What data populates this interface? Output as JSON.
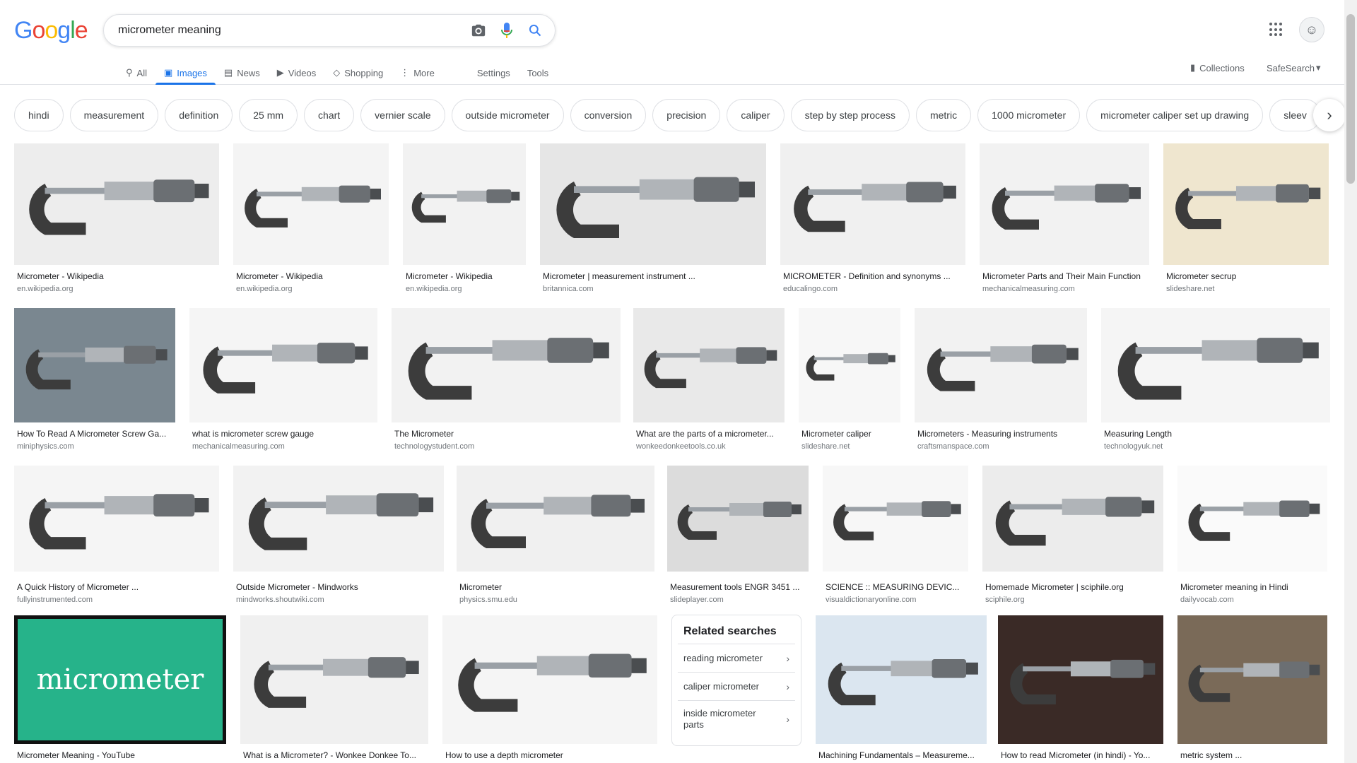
{
  "logo": {
    "letters": [
      "G",
      "o",
      "o",
      "g",
      "l",
      "e"
    ],
    "colors": [
      "#4285f4",
      "#ea4335",
      "#fbbc05",
      "#4285f4",
      "#34a853",
      "#ea4335"
    ]
  },
  "search": {
    "value": "micrometer meaning"
  },
  "tabs": [
    {
      "label": "All",
      "icon": "search-icon"
    },
    {
      "label": "Images",
      "icon": "image-icon",
      "active": true
    },
    {
      "label": "News",
      "icon": "news-icon"
    },
    {
      "label": "Videos",
      "icon": "video-icon"
    },
    {
      "label": "Shopping",
      "icon": "tag-icon"
    },
    {
      "label": "More",
      "icon": "more-vert-icon"
    }
  ],
  "tools": {
    "settings": "Settings",
    "tools": "Tools"
  },
  "collections": "Collections",
  "safesearch": "SafeSearch",
  "chips": [
    "hindi",
    "measurement",
    "definition",
    "25 mm",
    "chart",
    "vernier scale",
    "outside micrometer",
    "conversion",
    "precision",
    "caliper",
    "step by step process",
    "metric",
    "1000 micrometer",
    "micrometer caliper set up drawing",
    "sleev"
  ],
  "results": [
    {
      "title": "Micrometer - Wikipedia",
      "source": "en.wikipedia.org",
      "bg": "#ededed"
    },
    {
      "title": "Micrometer - Wikipedia",
      "source": "en.wikipedia.org",
      "bg": "#f4f4f4"
    },
    {
      "title": "Micrometer - Wikipedia",
      "source": "en.wikipedia.org",
      "bg": "#f2f2f2"
    },
    {
      "title": "Micrometer | measurement instrument ...",
      "source": "britannica.com",
      "bg": "#e6e6e6"
    },
    {
      "title": "MICROMETER - Definition and synonyms ...",
      "source": "educalingo.com",
      "bg": "#f0f0f0"
    },
    {
      "title": "Micrometer Parts and Their Main Function",
      "source": "mechanicalmeasuring.com",
      "bg": "#f2f2f2"
    },
    {
      "title": "Micrometer secrup",
      "source": "slideshare.net",
      "bg": "#efe6cf"
    },
    {
      "title": "How To Read A Micrometer Screw Ga...",
      "source": "miniphysics.com",
      "bg": "#7a8790"
    },
    {
      "title": "what is micrometer screw gauge",
      "source": "mechanicalmeasuring.com",
      "bg": "#f5f5f5"
    },
    {
      "title": "The Micrometer",
      "source": "technologystudent.com",
      "bg": "#f2f2f2"
    },
    {
      "title": "What are the parts of a micrometer...",
      "source": "wonkeedonkeetools.co.uk",
      "bg": "#e9e9e9"
    },
    {
      "title": "Micrometer caliper",
      "source": "slideshare.net",
      "bg": "#f7f7f7"
    },
    {
      "title": "Micrometers - Measuring instruments",
      "source": "craftsmanspace.com",
      "bg": "#f2f2f2"
    },
    {
      "title": "Measuring Length",
      "source": "technologyuk.net",
      "bg": "#f5f5f5"
    },
    {
      "title": "A Quick History of Micrometer ...",
      "source": "fullyinstrumented.com",
      "bg": "#f5f5f5"
    },
    {
      "title": "Outside Micrometer - Mindworks",
      "source": "mindworks.shoutwiki.com",
      "bg": "#f2f2f2"
    },
    {
      "title": "Micrometer",
      "source": "physics.smu.edu",
      "bg": "#f0f0f0"
    },
    {
      "title": "Measurement tools ENGR 3451 ...",
      "source": "slideplayer.com",
      "bg": "#dcdcdc"
    },
    {
      "title": "SCIENCE :: MEASURING DEVIC...",
      "source": "visualdictionaryonline.com",
      "bg": "#f7f7f7"
    },
    {
      "title": "Homemade Micrometer | sciphile.org",
      "source": "sciphile.org",
      "bg": "#ececec"
    },
    {
      "title": "Micrometer meaning in Hindi",
      "source": "dailyvocab.com",
      "bg": "#fafafa"
    },
    {
      "title": "Micrometer Meaning - YouTube",
      "source": "",
      "bg": "#26b38a",
      "overlay": "micrometer"
    },
    {
      "title": "What is a Micrometer? - Wonkee Donkee To...",
      "source": "",
      "bg": "#f0f0f0"
    },
    {
      "title": "How to use a depth micrometer",
      "source": "",
      "bg": "#f5f5f5"
    },
    {
      "title": "Machining Fundamentals – Measureme...",
      "source": "",
      "bg": "#dbe6f0"
    },
    {
      "title": "How to read Micrometer (in hindi) - Yo...",
      "source": "",
      "bg": "#3a2a26"
    },
    {
      "title": "metric system ...",
      "source": "",
      "bg": "#7a6a58"
    }
  ],
  "related": {
    "heading": "Related searches",
    "items": [
      "reading micrometer",
      "caliper micrometer",
      "inside micrometer parts"
    ]
  }
}
